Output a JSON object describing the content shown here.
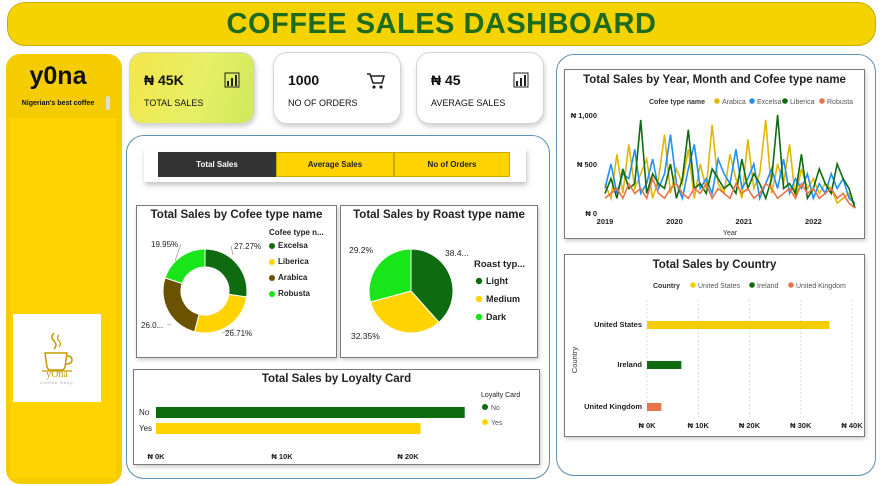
{
  "header": {
    "title": "COFFEE SALES DASHBOARD"
  },
  "sidebar": {
    "brand": "y0na",
    "tagline": "Nigerian's best coffee",
    "logo_text": "yOna",
    "logo_sub": "Coffee Shop"
  },
  "kpis": [
    {
      "value": "₦ 45K",
      "label": "TOTAL SALES",
      "icon": "bar-chart-icon"
    },
    {
      "value": "1000",
      "label": "NO OF ORDERS",
      "icon": "cart-icon"
    },
    {
      "value": "₦ 45",
      "label": "AVERAGE SALES",
      "icon": "bar-chart-icon"
    }
  ],
  "toggle": {
    "buttons": [
      "Total Sales",
      "Average Sales",
      "No of Orders"
    ],
    "active": "Total Sales"
  },
  "colors": {
    "yellow": "#f5cc00",
    "green": "#1e6b1e",
    "dark_green": "#0f6b0f",
    "olive": "#6b5200",
    "bright_green": "#19e619",
    "blue": "#1e90ff",
    "orange": "#e8744a",
    "gold": "#e0b800"
  },
  "chart_data": [
    {
      "id": "coffee-type-donut",
      "type": "pie",
      "title": "Total Sales by Cofee type name",
      "legend_title": "Cofee type n...",
      "categories": [
        "Excelsa",
        "Liberica",
        "Arabica",
        "Robusta"
      ],
      "values": [
        27.27,
        26.71,
        26.07,
        19.95
      ],
      "labels": [
        "27.27%",
        "26.71%",
        "26.0...",
        "19.95%"
      ],
      "colors": [
        "#0f6b0f",
        "#ffd300",
        "#6b5200",
        "#19e619"
      ],
      "donut": true
    },
    {
      "id": "roast-type-pie",
      "type": "pie",
      "title": "Total Sales by Roast type name",
      "legend_title": "Roast typ...",
      "categories": [
        "Light",
        "Medium",
        "Dark"
      ],
      "values": [
        38.4,
        32.35,
        29.2
      ],
      "labels": [
        "38.4...",
        "32.35%",
        "29.2%"
      ],
      "colors": [
        "#0f6b0f",
        "#ffd300",
        "#19e619"
      ],
      "donut": false
    },
    {
      "id": "loyalty-bar",
      "type": "bar",
      "title": "Total Sales by Loyalty Card",
      "legend_title": "Loyalty Card",
      "categories": [
        "No",
        "Yes"
      ],
      "values": [
        24500,
        21000
      ],
      "colors": [
        "#0f6b0f",
        "#ffd300"
      ],
      "xlim": [
        0,
        20000
      ],
      "xticks": [
        "₦ 0K",
        "₦ 10K",
        "₦ 20K"
      ],
      "xtick_values": [
        0,
        10000,
        20000
      ]
    },
    {
      "id": "year-month-line",
      "type": "line",
      "title": "Total Sales by Year, Month and Cofee type name",
      "legend_title": "Cofee type name",
      "xlabel": "Year",
      "xticks": [
        "2019",
        "2020",
        "2021",
        "2022"
      ],
      "yticks": [
        "₦ 0",
        "₦ 500",
        "₦ 1,000"
      ],
      "ylim": [
        0,
        1000
      ],
      "x_range": [
        2019.0,
        2022.6
      ],
      "series": [
        {
          "name": "Arabica",
          "color": "#e0b800",
          "values": [
            300,
            150,
            600,
            200,
            700,
            250,
            400,
            550,
            150,
            350,
            800,
            200,
            450,
            300,
            650,
            150,
            500,
            250,
            900,
            300,
            200,
            600,
            350,
            150,
            750,
            250,
            400,
            950,
            200,
            500,
            300,
            700,
            150,
            450,
            250,
            350,
            200,
            300,
            250,
            100,
            150,
            200,
            50
          ]
        },
        {
          "name": "Excelsa",
          "color": "#1e90ff",
          "values": [
            250,
            500,
            200,
            400,
            350,
            650,
            200,
            300,
            550,
            250,
            400,
            800,
            300,
            150,
            450,
            700,
            250,
            350,
            200,
            550,
            400,
            300,
            650,
            250,
            350,
            500,
            150,
            300,
            450,
            250,
            550,
            200,
            350,
            250,
            400,
            150,
            300,
            200,
            400,
            250,
            350,
            150,
            100
          ]
        },
        {
          "name": "Liberica",
          "color": "#0f6b0f",
          "values": [
            200,
            350,
            150,
            450,
            250,
            300,
            950,
            200,
            400,
            300,
            250,
            500,
            150,
            350,
            850,
            250,
            300,
            200,
            450,
            350,
            250,
            300,
            200,
            550,
            250,
            400,
            300,
            150,
            350,
            1000,
            250,
            300,
            200,
            600,
            150,
            250,
            450,
            300,
            200,
            500,
            350,
            250,
            50
          ]
        },
        {
          "name": "Robusta",
          "color": "#e8744a",
          "values": [
            150,
            200,
            250,
            150,
            300,
            200,
            250,
            150,
            350,
            200,
            150,
            250,
            300,
            200,
            150,
            250,
            200,
            300,
            150,
            250,
            200,
            150,
            300,
            200,
            250,
            150,
            200,
            300,
            250,
            150,
            200,
            250,
            150,
            300,
            200,
            250,
            150,
            200,
            250,
            150,
            200,
            100,
            50
          ]
        }
      ]
    },
    {
      "id": "country-bar",
      "type": "bar",
      "title": "Total Sales by Country",
      "legend_title": "Country",
      "ylabel": "Country",
      "categories": [
        "United States",
        "Ireland",
        "United Kingdom"
      ],
      "values": [
        35600,
        6700,
        2800
      ],
      "colors": [
        "#f5cc00",
        "#0f6b0f",
        "#e8744a"
      ],
      "xlim": [
        0,
        40000
      ],
      "xticks": [
        "₦ 0K",
        "₦ 10K",
        "₦ 20K",
        "₦ 30K",
        "₦ 40K"
      ],
      "xtick_values": [
        0,
        10000,
        20000,
        30000,
        40000
      ]
    }
  ]
}
